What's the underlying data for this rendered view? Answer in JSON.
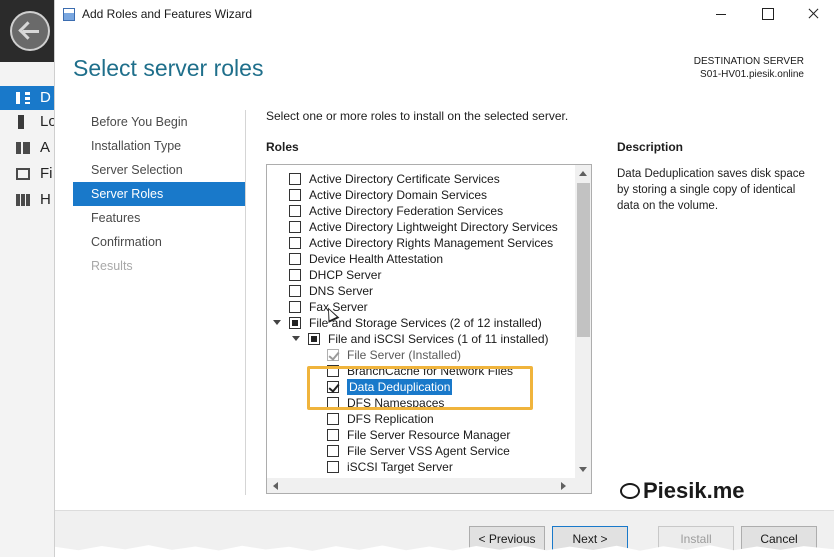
{
  "background_app": {
    "nav_items": [
      {
        "label": "D",
        "active": true,
        "icon": "dashboard-icon"
      },
      {
        "label": "Lo",
        "active": false,
        "icon": "local-server-icon"
      },
      {
        "label": "A",
        "active": false,
        "icon": "all-servers-icon"
      },
      {
        "label": "Fi",
        "active": false,
        "icon": "file-services-icon"
      },
      {
        "label": "H",
        "active": false,
        "icon": "hyper-v-icon"
      }
    ]
  },
  "window": {
    "title": "Add Roles and Features Wizard"
  },
  "header": {
    "page_title": "Select server roles",
    "destination_label": "DESTINATION SERVER",
    "destination_value": "S01-HV01.piesik.online"
  },
  "steps": [
    {
      "label": "Before You Begin",
      "state": "normal"
    },
    {
      "label": "Installation Type",
      "state": "normal"
    },
    {
      "label": "Server Selection",
      "state": "normal"
    },
    {
      "label": "Server Roles",
      "state": "active"
    },
    {
      "label": "Features",
      "state": "normal"
    },
    {
      "label": "Confirmation",
      "state": "normal"
    },
    {
      "label": "Results",
      "state": "disabled"
    }
  ],
  "main": {
    "instruction": "Select one or more roles to install on the selected server.",
    "roles_heading": "Roles",
    "description_heading": "Description",
    "description_text": "Data Deduplication saves disk space by storing a single copy of identical data on the volume."
  },
  "roles": [
    {
      "label": "Active Directory Certificate Services",
      "level": 0,
      "state": "unchecked"
    },
    {
      "label": "Active Directory Domain Services",
      "level": 0,
      "state": "unchecked"
    },
    {
      "label": "Active Directory Federation Services",
      "level": 0,
      "state": "unchecked"
    },
    {
      "label": "Active Directory Lightweight Directory Services",
      "level": 0,
      "state": "unchecked"
    },
    {
      "label": "Active Directory Rights Management Services",
      "level": 0,
      "state": "unchecked"
    },
    {
      "label": "Device Health Attestation",
      "level": 0,
      "state": "unchecked"
    },
    {
      "label": "DHCP Server",
      "level": 0,
      "state": "unchecked"
    },
    {
      "label": "DNS Server",
      "level": 0,
      "state": "unchecked"
    },
    {
      "label": "Fax Server",
      "level": 0,
      "state": "unchecked"
    },
    {
      "label": "File and Storage Services (2 of 12 installed)",
      "level": 0,
      "state": "partial",
      "expanded": true
    },
    {
      "label": "File and iSCSI Services (1 of 11 installed)",
      "level": 1,
      "state": "partial",
      "expanded": true
    },
    {
      "label": "File Server (Installed)",
      "level": 2,
      "state": "checked-installed"
    },
    {
      "label": "BranchCache for Network Files",
      "level": 2,
      "state": "unchecked"
    },
    {
      "label": "Data Deduplication",
      "level": 2,
      "state": "checked",
      "selected": true
    },
    {
      "label": "DFS Namespaces",
      "level": 2,
      "state": "unchecked"
    },
    {
      "label": "DFS Replication",
      "level": 2,
      "state": "unchecked"
    },
    {
      "label": "File Server Resource Manager",
      "level": 2,
      "state": "unchecked"
    },
    {
      "label": "File Server VSS Agent Service",
      "level": 2,
      "state": "unchecked"
    },
    {
      "label": "iSCSI Target Server",
      "level": 2,
      "state": "unchecked"
    }
  ],
  "watermark": {
    "prefix": "Piesik",
    "suffix": ".me"
  },
  "footer": {
    "previous": "< Previous",
    "next": "Next >",
    "install": "Install",
    "cancel": "Cancel"
  },
  "colors": {
    "accent": "#1979ca",
    "title": "#1f6f8b",
    "highlight": "#f0b43c"
  }
}
